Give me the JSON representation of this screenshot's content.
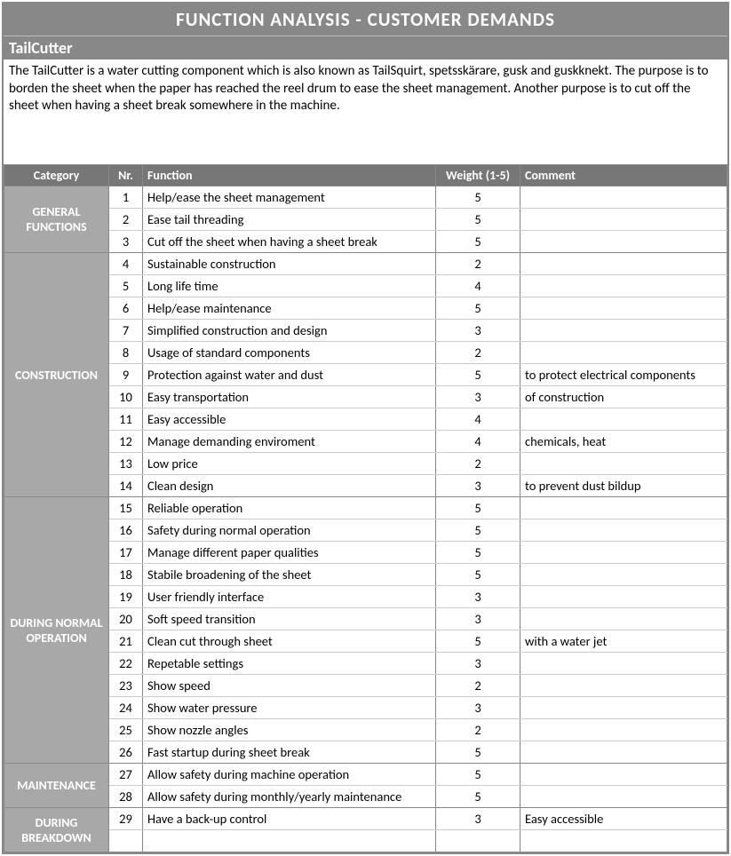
{
  "header": {
    "title": "FUNCTION ANALYSIS - CUSTOMER DEMANDS",
    "subtitle": "TailCutter",
    "description": "The TailCutter is a water cutting component which is also known as TailSquirt, spetsskärare, gusk and guskknekt. The purpose is to borden the sheet when the paper has reached the reel drum to ease the sheet management. Another purpose is to cut off the sheet when having a sheet break somewhere in the machine."
  },
  "columns": {
    "category": "Category",
    "nr": "Nr.",
    "function": "Function",
    "weight": "Weight (1-5)",
    "comment": "Comment"
  },
  "groups": [
    {
      "name": "GENERAL FUNCTIONS",
      "rows": [
        {
          "nr": "1",
          "fn": "Help/ease the sheet management",
          "wt": "5",
          "cm": ""
        },
        {
          "nr": "2",
          "fn": "Ease tail threading",
          "wt": "5",
          "cm": ""
        },
        {
          "nr": "3",
          "fn": "Cut off the sheet when having a sheet break",
          "wt": "5",
          "cm": ""
        }
      ]
    },
    {
      "name": "CONSTRUCTION",
      "rows": [
        {
          "nr": "4",
          "fn": "Sustainable construction",
          "wt": "2",
          "cm": ""
        },
        {
          "nr": "5",
          "fn": "Long life time",
          "wt": "4",
          "cm": ""
        },
        {
          "nr": "6",
          "fn": "Help/ease maintenance",
          "wt": "5",
          "cm": ""
        },
        {
          "nr": "7",
          "fn": "Simplified construction and design",
          "wt": "3",
          "cm": ""
        },
        {
          "nr": "8",
          "fn": "Usage of standard components",
          "wt": "2",
          "cm": ""
        },
        {
          "nr": "9",
          "fn": "Protection against water and dust",
          "wt": "5",
          "cm": "to protect electrical components"
        },
        {
          "nr": "10",
          "fn": "Easy transportation",
          "wt": "3",
          "cm": "of construction"
        },
        {
          "nr": "11",
          "fn": "Easy accessible",
          "wt": "4",
          "cm": ""
        },
        {
          "nr": "12",
          "fn": "Manage demanding enviroment",
          "wt": "4",
          "cm": "chemicals, heat"
        },
        {
          "nr": "13",
          "fn": "Low price",
          "wt": "2",
          "cm": ""
        },
        {
          "nr": "14",
          "fn": "Clean design",
          "wt": "3",
          "cm": "to prevent dust bildup"
        }
      ]
    },
    {
      "name": "DURING NORMAL OPERATION",
      "rows": [
        {
          "nr": "15",
          "fn": "Reliable operation",
          "wt": "5",
          "cm": ""
        },
        {
          "nr": "16",
          "fn": "Safety during normal operation",
          "wt": "5",
          "cm": ""
        },
        {
          "nr": "17",
          "fn": "Manage different paper qualities",
          "wt": "5",
          "cm": ""
        },
        {
          "nr": "18",
          "fn": "Stabile broadening of the sheet",
          "wt": "5",
          "cm": ""
        },
        {
          "nr": "19",
          "fn": "User friendly interface",
          "wt": "3",
          "cm": ""
        },
        {
          "nr": "20",
          "fn": "Soft speed transition",
          "wt": "3",
          "cm": ""
        },
        {
          "nr": "21",
          "fn": "Clean cut through sheet",
          "wt": "5",
          "cm": "with a water jet"
        },
        {
          "nr": "22",
          "fn": "Repetable settings",
          "wt": "3",
          "cm": ""
        },
        {
          "nr": "23",
          "fn": "Show speed",
          "wt": "2",
          "cm": ""
        },
        {
          "nr": "24",
          "fn": "Show water pressure",
          "wt": "3",
          "cm": ""
        },
        {
          "nr": "25",
          "fn": "Show nozzle angles",
          "wt": "2",
          "cm": ""
        },
        {
          "nr": "26",
          "fn": "Fast startup during sheet break",
          "wt": "5",
          "cm": ""
        }
      ]
    },
    {
      "name": "MAINTENANCE",
      "rows": [
        {
          "nr": "27",
          "fn": "Allow safety during machine operation",
          "wt": "5",
          "cm": ""
        },
        {
          "nr": "28",
          "fn": "Allow safety during monthly/yearly maintenance",
          "wt": "5",
          "cm": ""
        }
      ]
    },
    {
      "name": "DURING BREAKDOWN",
      "rows": [
        {
          "nr": "29",
          "fn": "Have a back-up control",
          "wt": "3",
          "cm": "Easy accessible"
        },
        {
          "nr": "",
          "fn": "",
          "wt": "",
          "cm": ""
        }
      ]
    }
  ]
}
